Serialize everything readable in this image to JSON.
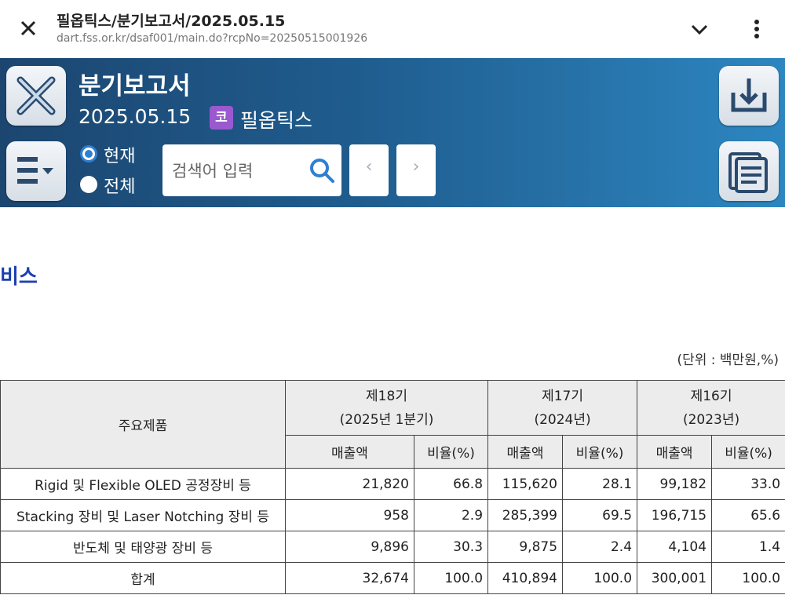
{
  "browser": {
    "title": "필옵틱스/분기보고서/2025.05.15",
    "url": "dart.fss.or.kr/dsaf001/main.do?rcpNo=20250515001926",
    "icons": [
      "close-icon",
      "chevron-down-icon",
      "more-vert-icon"
    ]
  },
  "header": {
    "doc_title": "분기보고서",
    "date": "2025.05.15",
    "corp_badge": "코",
    "corp_badge_color": "#9b59d0",
    "corp_name": "필옵틱스",
    "scope": {
      "current": "현재",
      "all": "전체",
      "selected": "현재"
    },
    "search": {
      "placeholder": "검색어 입력"
    },
    "prev_label": "‹",
    "next_label": "›",
    "accent": "#2f7fd0"
  },
  "content": {
    "section_title": "비스",
    "unit_note": "(단위 : 백만원,%)",
    "table": {
      "product_header": "주요제품",
      "periods": [
        {
          "term": "제18기",
          "period": "(2025년 1분기)"
        },
        {
          "term": "제17기",
          "period": "(2024년)"
        },
        {
          "term": "제16기",
          "period": "(2023년)"
        }
      ],
      "sales_label": "매출액",
      "ratio_label": "비율(%)",
      "rows": [
        {
          "name": "Rigid 및 Flexible OLED 공정장비 등",
          "values": [
            "21,820",
            "66.8",
            "115,620",
            "28.1",
            "99,182",
            "33.0"
          ]
        },
        {
          "name": "Stacking 장비 및 Laser Notching 장비 등",
          "values": [
            "958",
            "2.9",
            "285,399",
            "69.5",
            "196,715",
            "65.6"
          ]
        },
        {
          "name": "반도체 및 태양광 장비 등",
          "values": [
            "9,896",
            "30.3",
            "9,875",
            "2.4",
            "4,104",
            "1.4"
          ]
        },
        {
          "name": "합계",
          "values": [
            "32,674",
            "100.0",
            "410,894",
            "100.0",
            "300,001",
            "100.0"
          ]
        }
      ]
    }
  }
}
